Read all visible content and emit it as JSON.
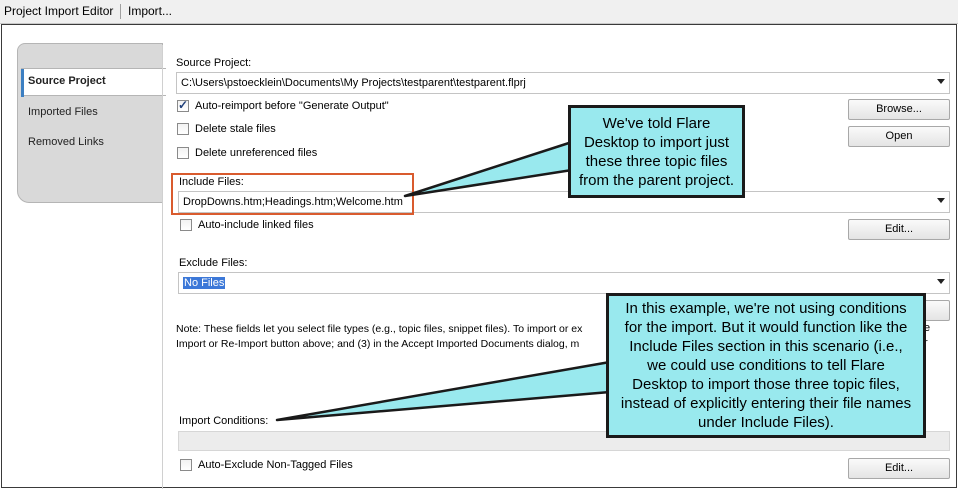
{
  "topbar": {
    "tab_editor": "Project Import Editor",
    "tab_import": "Import..."
  },
  "sidebar": {
    "items": [
      {
        "label": "Source Project"
      },
      {
        "label": "Imported Files"
      },
      {
        "label": "Removed Links"
      }
    ]
  },
  "form": {
    "source_project_label": "Source Project:",
    "source_project_value": "C:\\Users\\pstoecklein\\Documents\\My Projects\\testparent\\testparent.flprj",
    "auto_reimport_label": "Auto-reimport before \"Generate Output\"",
    "auto_reimport_checked": true,
    "delete_stale_label": "Delete stale files",
    "delete_unreferenced_label": "Delete unreferenced files",
    "browse_button": "Browse...",
    "open_button": "Open",
    "include_files_label": "Include Files:",
    "include_files_value": "DropDowns.htm;Headings.htm;Welcome.htm",
    "auto_include_label": "Auto-include linked files",
    "edit_include_button": "Edit...",
    "exclude_files_label": "Exclude Files:",
    "exclude_files_value": "No Files",
    "note_line1": "Note: These fields let you select file types (e.g., topic files, snippet files). To import or ex",
    "note_line1_tail": "e",
    "note_line2": "Import or Re-Import button above; and (3) in the Accept Imported Documents dialog, m",
    "note_line2_tail": "r",
    "import_conditions_label": "Import Conditions:",
    "auto_exclude_label": "Auto-Exclude Non-Tagged Files",
    "edit_conditions_button": "Edit..."
  },
  "callouts": {
    "top": [
      "We've told Flare",
      "Desktop to import just",
      "these three topic files",
      "from the parent project."
    ],
    "bottom": [
      "In this example, we're not using conditions",
      "for the import. But it would function like the",
      "Include Files section in this scenario (i.e.,",
      "we could use conditions to tell Flare",
      "Desktop to import those three topic files,",
      "instead of explicitly entering their file names",
      "under Include Files)."
    ]
  },
  "colors": {
    "callout_fill": "#99e9ee",
    "highlight_box": "#d95b2e",
    "selection": "#3c78d8"
  }
}
